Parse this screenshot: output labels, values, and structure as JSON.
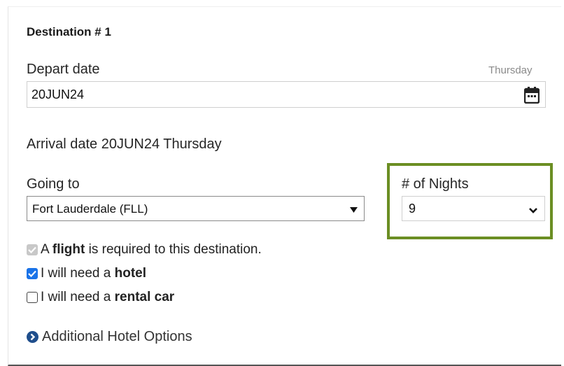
{
  "section_title": "Destination # 1",
  "depart": {
    "label": "Depart date",
    "weekday_hint": "Thursday",
    "value": "20JUN24"
  },
  "arrival_text": "Arrival date 20JUN24 Thursday",
  "going_to": {
    "label": "Going to",
    "selected": "Fort Lauderdale (FLL)"
  },
  "nights": {
    "label": "# of Nights",
    "selected": "9"
  },
  "checkboxes": {
    "flight": {
      "prefix": "A ",
      "bold": "flight",
      "suffix": " is required to this destination.",
      "checked": true,
      "disabled": true
    },
    "hotel": {
      "prefix": "I will need a ",
      "bold": "hotel",
      "suffix": "",
      "checked": true
    },
    "car": {
      "prefix": "I will need a ",
      "bold": "rental car",
      "suffix": "",
      "checked": false
    }
  },
  "additional_options": "Additional Hotel Options",
  "colors": {
    "highlight_border": "#6b8e23",
    "checkbox_checked": "#1a73e8",
    "link_icon": "#1f4e8c"
  }
}
